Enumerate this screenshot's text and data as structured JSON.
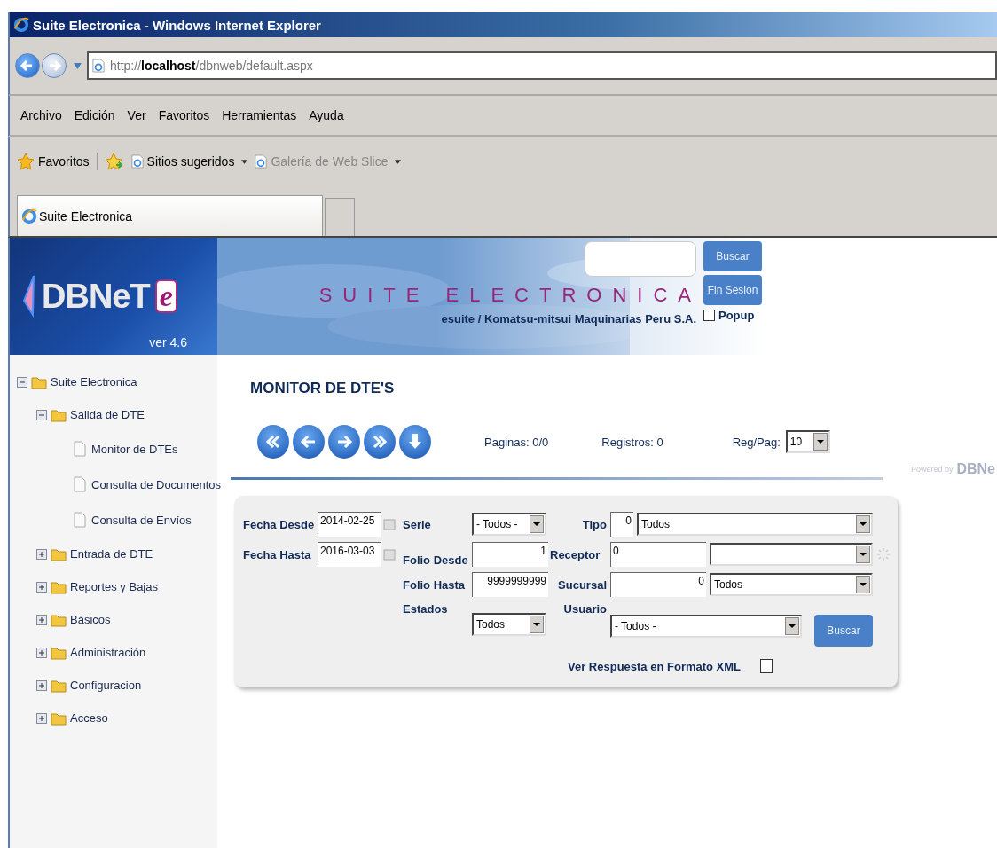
{
  "browser": {
    "title": "Suite Electronica - Windows Internet Explorer",
    "url": {
      "scheme": "http://",
      "host": "localhost",
      "path": "/dbnweb/default.aspx"
    },
    "menu": [
      "Archivo",
      "Edición",
      "Ver",
      "Favoritos",
      "Herramientas",
      "Ayuda"
    ],
    "favorites": {
      "label": "Favoritos",
      "links": [
        {
          "label": "Sitios sugeridos",
          "disabled": false
        },
        {
          "label": "Galería de Web Slice",
          "disabled": true
        }
      ]
    },
    "tab": "Suite Electronica"
  },
  "header": {
    "logo": "DBNeT",
    "mark": "e",
    "version": "ver 4.6",
    "title": "SUITE ELECTRONICA",
    "buttons": [
      "Buscar",
      "Fin Sesion"
    ],
    "subtitle": "esuite / Komatsu-mitsui Maquinarias Peru S.A.",
    "popup": {
      "label": "Popup",
      "checked": false
    }
  },
  "sidebar": {
    "items": [
      {
        "label": "Suite Electronica",
        "expanded": true,
        "children": [
          {
            "label": "Salida de DTE",
            "expanded": true,
            "children": [
              {
                "label": "Monitor de DTEs"
              },
              {
                "label": "Consulta de Documentos"
              },
              {
                "label": "Consulta de Envíos"
              }
            ]
          },
          {
            "label": "Entrada de DTE",
            "expanded": false
          },
          {
            "label": "Reportes y Bajas",
            "expanded": false
          },
          {
            "label": "Básicos",
            "expanded": false
          },
          {
            "label": "Administración",
            "expanded": false
          },
          {
            "label": "Configuracion",
            "expanded": false
          },
          {
            "label": "Acceso",
            "expanded": false
          }
        ]
      }
    ]
  },
  "page": {
    "title": "MONITOR DE DTE'S",
    "pages": "Paginas: 0/0",
    "records": "Registros: 0",
    "per_page": {
      "label": "Reg/Pag:",
      "value": "10"
    },
    "powered": {
      "prefix": "Powered by",
      "brand": "DBNe"
    }
  },
  "form": {
    "fecha_desde": {
      "label": "Fecha Desde",
      "value": "2014-02-25"
    },
    "fecha_hasta": {
      "label": "Fecha Hasta",
      "value": "2016-03-03"
    },
    "serie": {
      "label": "Serie",
      "value": "- Todos -"
    },
    "folio_desde": {
      "label": "Folio Desde",
      "value": "1"
    },
    "folio_hasta": {
      "label": "Folio Hasta",
      "value": "9999999999"
    },
    "estados": {
      "label": "Estados",
      "value": "Todos"
    },
    "tipo": {
      "label": "Tipo",
      "code": "0",
      "value": "Todos"
    },
    "receptor": {
      "label": "Receptor",
      "code": "0"
    },
    "sucursal": {
      "label": "Sucursal",
      "code": "0",
      "value": "Todos"
    },
    "usuario": {
      "label": "Usuario",
      "value": "- Todos -"
    },
    "search": "Buscar",
    "xml": {
      "label": "Ver Respuesta en Formato XML",
      "checked": false
    }
  }
}
